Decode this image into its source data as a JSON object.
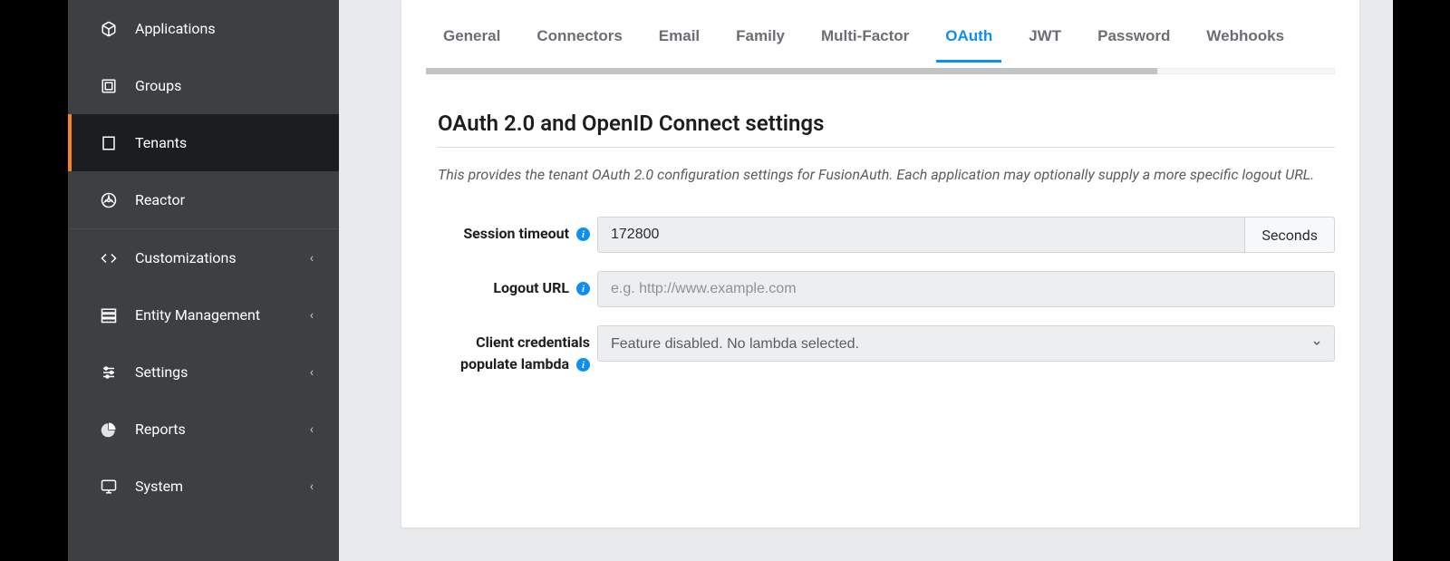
{
  "sidebar": {
    "items": [
      {
        "label": "Applications"
      },
      {
        "label": "Groups"
      },
      {
        "label": "Tenants"
      },
      {
        "label": "Reactor"
      },
      {
        "label": "Customizations"
      },
      {
        "label": "Entity Management"
      },
      {
        "label": "Settings"
      },
      {
        "label": "Reports"
      },
      {
        "label": "System"
      }
    ]
  },
  "tabs": {
    "general": "General",
    "connectors": "Connectors",
    "email": "Email",
    "family": "Family",
    "multi_factor": "Multi-Factor",
    "oauth": "OAuth",
    "jwt": "JWT",
    "password": "Password",
    "webhooks": "Webhooks"
  },
  "section": {
    "title": "OAuth 2.0 and OpenID Connect settings",
    "description": "This provides the tenant OAuth 2.0 configuration settings for FusionAuth. Each application may optionally supply a more specific logout URL."
  },
  "form": {
    "session_timeout": {
      "label": "Session timeout",
      "value": "172800",
      "unit": "Seconds"
    },
    "logout_url": {
      "label": "Logout URL",
      "placeholder": "e.g. http://www.example.com",
      "value": ""
    },
    "client_credentials": {
      "label": "Client credentials populate lambda",
      "value": "Feature disabled. No lambda selected."
    }
  }
}
